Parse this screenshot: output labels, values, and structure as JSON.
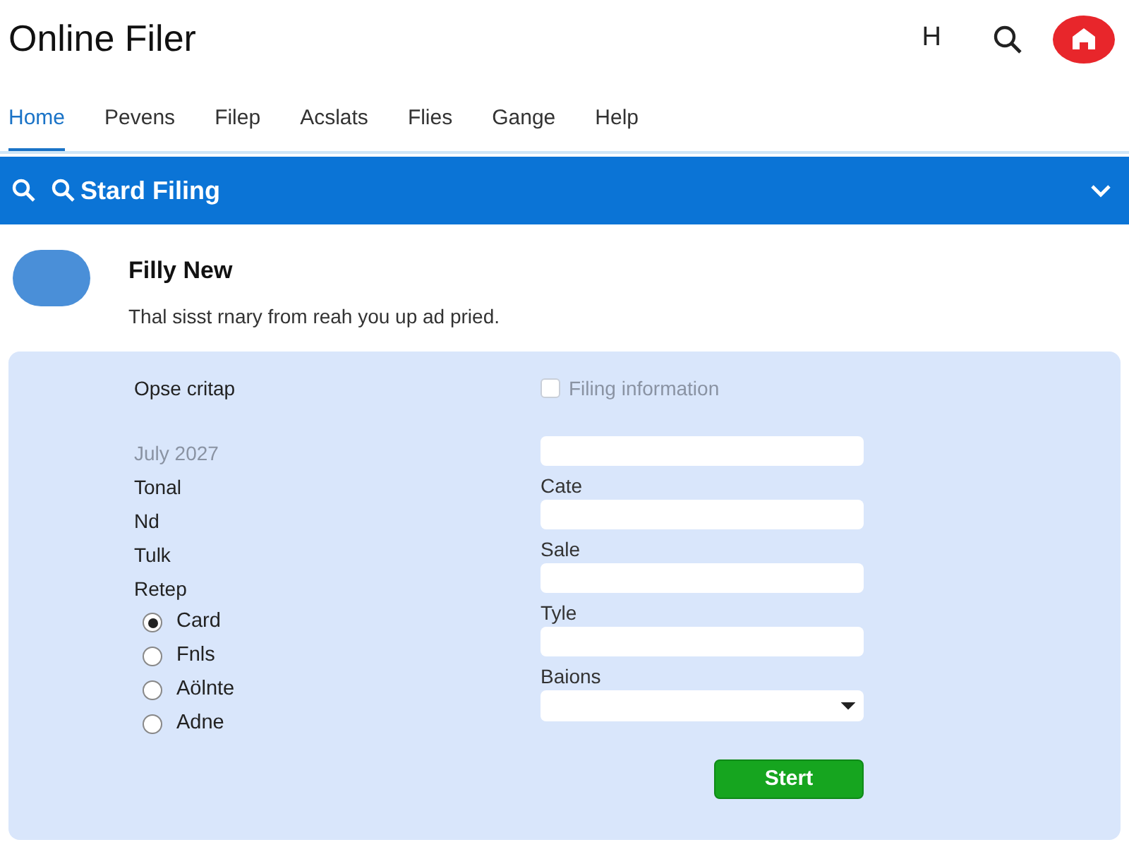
{
  "header": {
    "title": "Online Filer",
    "letter": "H"
  },
  "tabs": [
    {
      "label": "Home",
      "selected": true
    },
    {
      "label": "Pevens",
      "selected": false
    },
    {
      "label": "Filep",
      "selected": false
    },
    {
      "label": "Acslats",
      "selected": false
    },
    {
      "label": "Flies",
      "selected": false
    },
    {
      "label": "Gange",
      "selected": false
    },
    {
      "label": "Help",
      "selected": false
    }
  ],
  "search_bar": {
    "title": "Stard Filing"
  },
  "profile": {
    "name": "Filly New",
    "text": "Thal sisst rnary from reah you up ad pried."
  },
  "form": {
    "left": [
      {
        "kind": "label",
        "text": "Opse critap"
      },
      {
        "kind": "value",
        "text": "July 2027"
      },
      {
        "kind": "label",
        "text": "Tonal"
      },
      {
        "kind": "label",
        "text": "Nd"
      },
      {
        "kind": "label",
        "text": "Tulk"
      },
      {
        "kind": "label",
        "text": "Retep"
      }
    ],
    "radios": [
      {
        "label": "Card",
        "selected": true
      },
      {
        "label": "Fnls",
        "selected": false
      },
      {
        "label": "Aölnte",
        "selected": false
      },
      {
        "label": "Adne",
        "selected": false
      }
    ],
    "checkbox": {
      "label": "Filing information",
      "checked": false
    },
    "fields": [
      {
        "label": "Cate",
        "kind": "text"
      },
      {
        "label": "Sale",
        "kind": "text"
      },
      {
        "label": "Tyle",
        "kind": "text"
      },
      {
        "label": "Baions",
        "kind": "select"
      }
    ],
    "button": "Stert"
  }
}
